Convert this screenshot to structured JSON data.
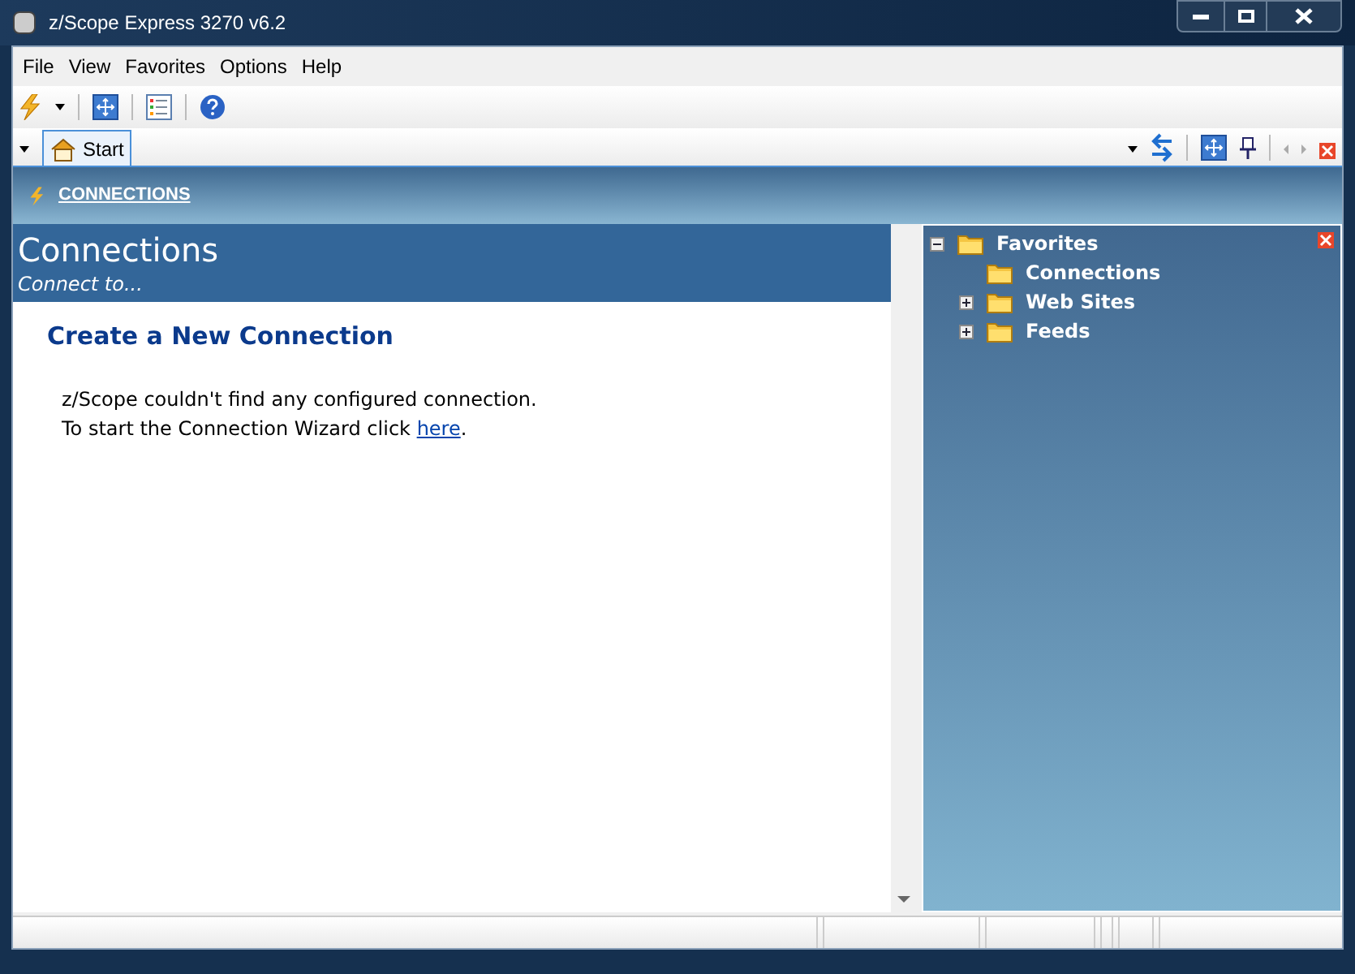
{
  "window": {
    "title": "z/Scope Express 3270 v6.2"
  },
  "menu": [
    "File",
    "View",
    "Favorites",
    "Options",
    "Help"
  ],
  "tabs": [
    {
      "label": "Start",
      "selected": true
    }
  ],
  "breadcrumb": "CONNECTIONS",
  "panel": {
    "title": "Connections",
    "subtitle": "Connect to...",
    "heading": "Create a New Connection",
    "line_1": "z/Scope couldn't find any configured connection.",
    "line_2_before": "To start the Connection Wizard click ",
    "link": "here",
    "line_2_after": "."
  },
  "tree": [
    {
      "label": "Favorites",
      "expanded": true,
      "children": [
        {
          "label": "Connections"
        },
        {
          "label": "Web Sites",
          "expanded": false
        },
        {
          "label": "Feeds",
          "expanded": false
        }
      ]
    }
  ]
}
